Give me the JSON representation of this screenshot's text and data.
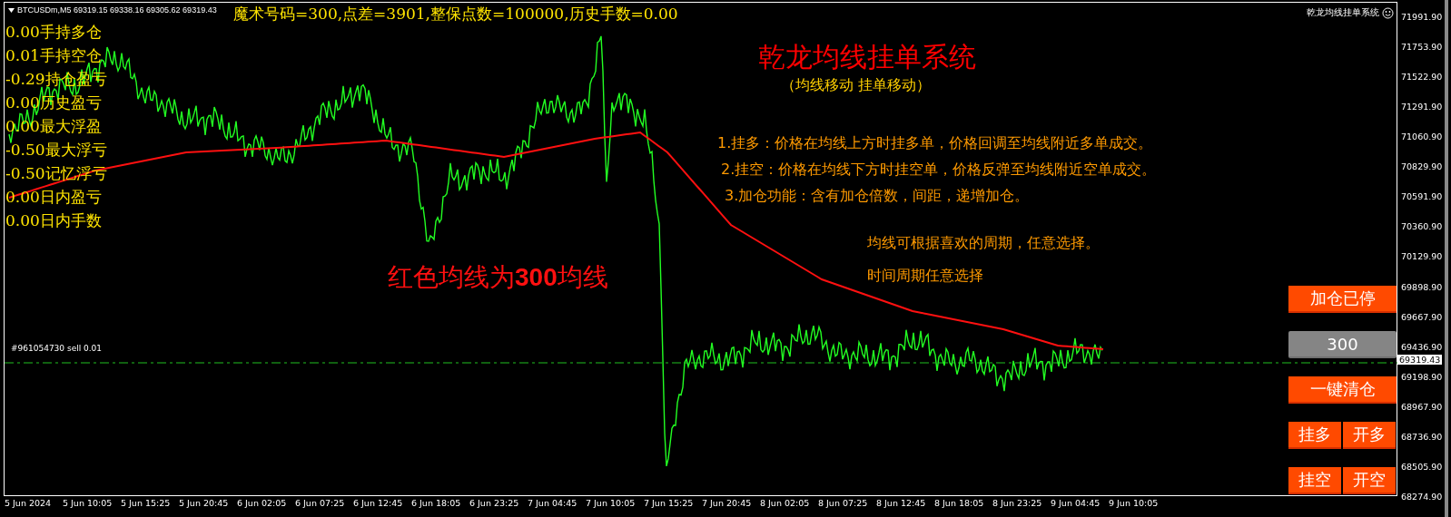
{
  "chart": {
    "symbol_info": "BTCUSDm,M5  69319.15 69338.16 69305.62 69319.43",
    "info_line": "魔术号码=300,点差=3901,整保点数=100000,历史手数=0.00",
    "indicator_name": "乾龙均线挂单系统",
    "stats": [
      "0.00手持多仓",
      "0.01手持空仓",
      "-0.29持仓盈亏",
      "0.00历史盈亏",
      "0.00最大浮盈",
      "-0.50最大浮亏",
      "-0.50记忆浮亏",
      "0.00日内盈亏",
      "0.00日内手数"
    ],
    "title": "乾龙均线挂单系统",
    "subtitle": "（均线移动 挂单移动）",
    "rules": [
      "1.挂多：价格在均线上方时挂多单，价格回调至均线附近多单成交。",
      "2.挂空：价格在均线下方时挂空单，价格反弹至均线附近空单成交。",
      "3.加仓功能：含有加仓倍数，间距，递增加仓。"
    ],
    "notes": [
      "均线可根据喜欢的周期，任意选择。",
      "时间周期任意选择"
    ],
    "ma_label": "红色均线为**300**均线",
    "order_label": "#961054730 sell 0.01",
    "price_axis": [
      "71991.90",
      "71753.90",
      "71522.90",
      "71291.90",
      "71060.90",
      "70829.90",
      "70591.90",
      "70360.90",
      "70129.90",
      "69898.90",
      "69667.90",
      "69436.90",
      "69198.90",
      "68967.90",
      "68736.90",
      "68505.90",
      "68274.90"
    ],
    "current_price": "69319.43",
    "time_axis": [
      "5 Jun 2024",
      "5 Jun 10:05",
      "5 Jun 15:25",
      "5 Jun 20:45",
      "6 Jun 02:05",
      "6 Jun 07:25",
      "6 Jun 12:45",
      "6 Jun 18:05",
      "6 Jun 23:25",
      "7 Jun 04:45",
      "7 Jun 10:05",
      "7 Jun 15:25",
      "7 Jun 20:45",
      "8 Jun 02:05",
      "8 Jun 07:25",
      "8 Jun 12:45",
      "8 Jun 18:05",
      "8 Jun 23:25",
      "9 Jun 04:45",
      "9 Jun 10:05"
    ]
  },
  "panel": [
    {
      "kind": "button",
      "labels": [
        "加仓已停"
      ]
    },
    {
      "kind": "value",
      "labels": [
        "300"
      ]
    },
    {
      "kind": "button",
      "labels": [
        "一键清仓"
      ]
    },
    {
      "kind": "pair",
      "labels": [
        "挂多",
        "开多"
      ]
    },
    {
      "kind": "pair",
      "labels": [
        "挂空",
        "开空"
      ]
    }
  ]
}
